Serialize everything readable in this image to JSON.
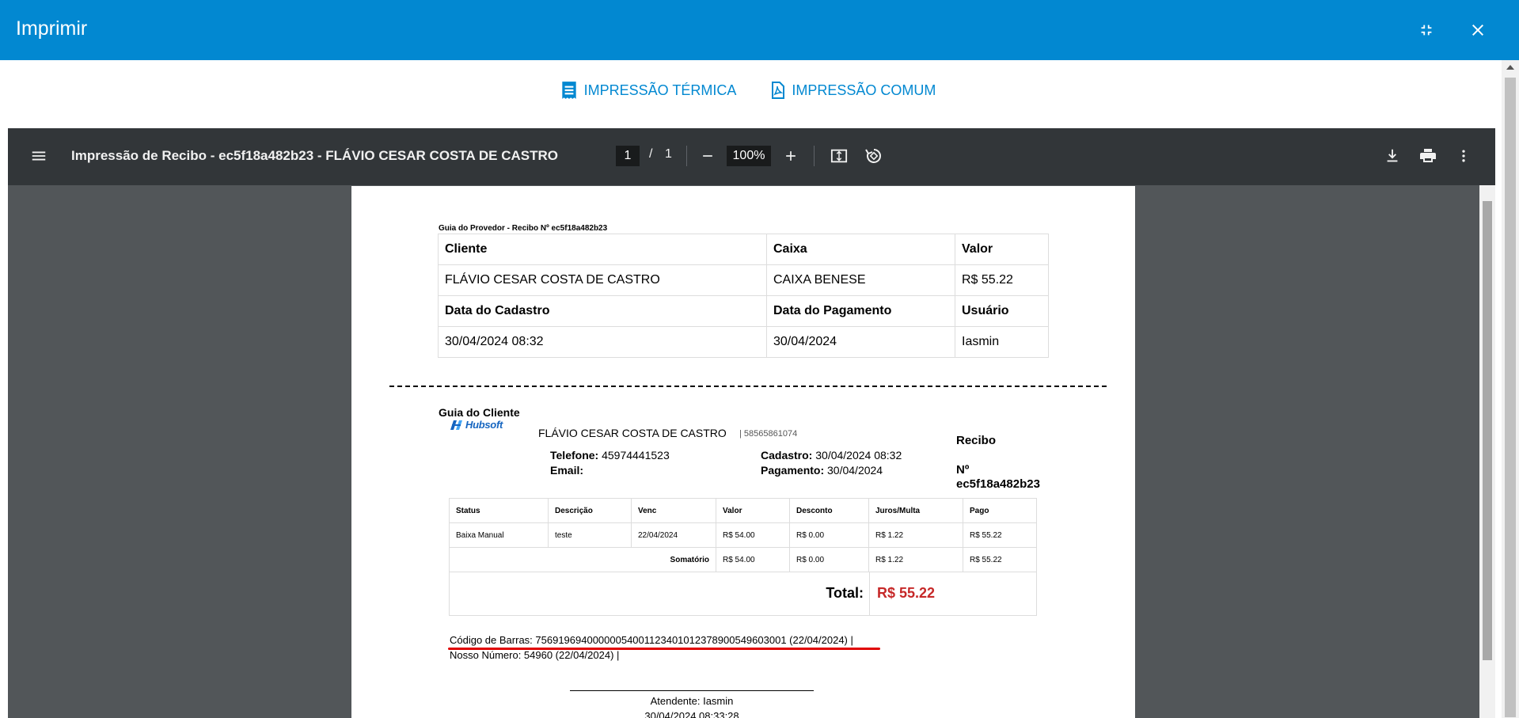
{
  "dialog": {
    "title": "Imprimir",
    "minimize_icon": "collapse-icon",
    "close_icon": "close-icon"
  },
  "print_options": [
    {
      "label": "IMPRESSÃO TÉRMICA",
      "icon": "receipt-icon"
    },
    {
      "label": "IMPRESSÃO COMUM",
      "icon": "pdf-icon"
    }
  ],
  "viewer": {
    "doc_title": "Impressão de Recibo - ec5f18a482b23 - FLÁVIO CESAR COSTA DE CASTRO",
    "current_page": "1",
    "page_separator": "/",
    "total_pages": "1",
    "zoom": "100%"
  },
  "receipt": {
    "provider_title": "Guia do Provedor - Recibo Nº ec5f18a482b23",
    "provider_table": {
      "row1_headers": [
        "Cliente",
        "Caixa",
        "Valor"
      ],
      "row1_values": [
        "FLÁVIO CESAR COSTA DE CASTRO",
        "CAIXA BENESE",
        "R$ 55.22"
      ],
      "row2_headers": [
        "Data do Cadastro",
        "Data do Pagamento",
        "Usuário"
      ],
      "row2_values": [
        "30/04/2024 08:32",
        "30/04/2024",
        "Iasmin"
      ]
    },
    "client_title": "Guia do Cliente",
    "logo_text": "Hubsoft",
    "customer_name": "FLÁVIO CESAR COSTA DE CASTRO",
    "customer_doc": "| 58565861074",
    "telefone_label": "Telefone:",
    "telefone_value": "45974441523",
    "email_label": "Email:",
    "email_value": "",
    "cadastro_label": "Cadastro:",
    "cadastro_value": "30/04/2024 08:32",
    "pagamento_label": "Pagamento:",
    "pagamento_value": "30/04/2024",
    "recibo_label": "Recibo",
    "recibo_no_label": "Nº",
    "recibo_no_value": "ec5f18a482b23",
    "items_table": {
      "headers": [
        "Status",
        "Descrição",
        "Venc",
        "Valor",
        "Desconto",
        "Juros/Multa",
        "Pago"
      ],
      "rows": [
        [
          "Baixa Manual",
          "teste",
          "22/04/2024",
          "R$ 54.00",
          "R$ 0.00",
          "R$ 1.22",
          "R$ 55.22"
        ]
      ],
      "sum_label": "Somatório",
      "sum_values": [
        "R$ 54.00",
        "R$ 0.00",
        "R$ 1.22",
        "R$ 55.22"
      ]
    },
    "total_label": "Total:",
    "total_value": "R$ 55.22",
    "barcode_text": "Código de Barras: 75691969400000054001123401012378900549603001 (22/04/2024) |",
    "nosso_numero_text": "Nosso Número: 54960 (22/04/2024) |",
    "atendente_text": "Atendente: Iasmin",
    "atendente_date": "30/04/2024 08:33:28"
  },
  "colors": {
    "titlebar": "#0288d1",
    "viewer_bg": "#525659",
    "viewer_toolbar": "#323639",
    "total_value": "#c62828",
    "underline": "#e00000"
  }
}
